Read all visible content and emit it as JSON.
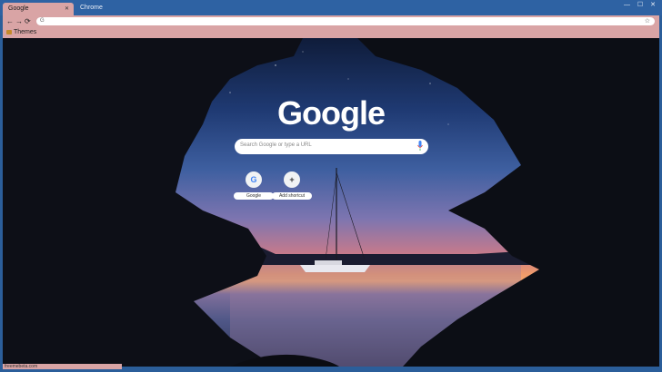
{
  "tabs": {
    "active": "Google",
    "inactive": "Chrome"
  },
  "toolbar": {
    "back": "←",
    "forward": "→",
    "reload": "⟳",
    "star": "☆",
    "omni_icon": "G"
  },
  "bookmarks": {
    "item": "Themes"
  },
  "newtab": {
    "logo": "Google",
    "search_placeholder": "Search Google or type a URL",
    "shortcuts": [
      {
        "label": "Google",
        "glyph": "G"
      },
      {
        "label": "Add shortcut",
        "glyph": "+"
      }
    ]
  },
  "status": "freemebeta.com",
  "window_controls": "— ☐ ✕",
  "colors": {
    "frame": "#2e62a3",
    "toolbar": "#d9a4a5",
    "logo": "#ffffff"
  }
}
